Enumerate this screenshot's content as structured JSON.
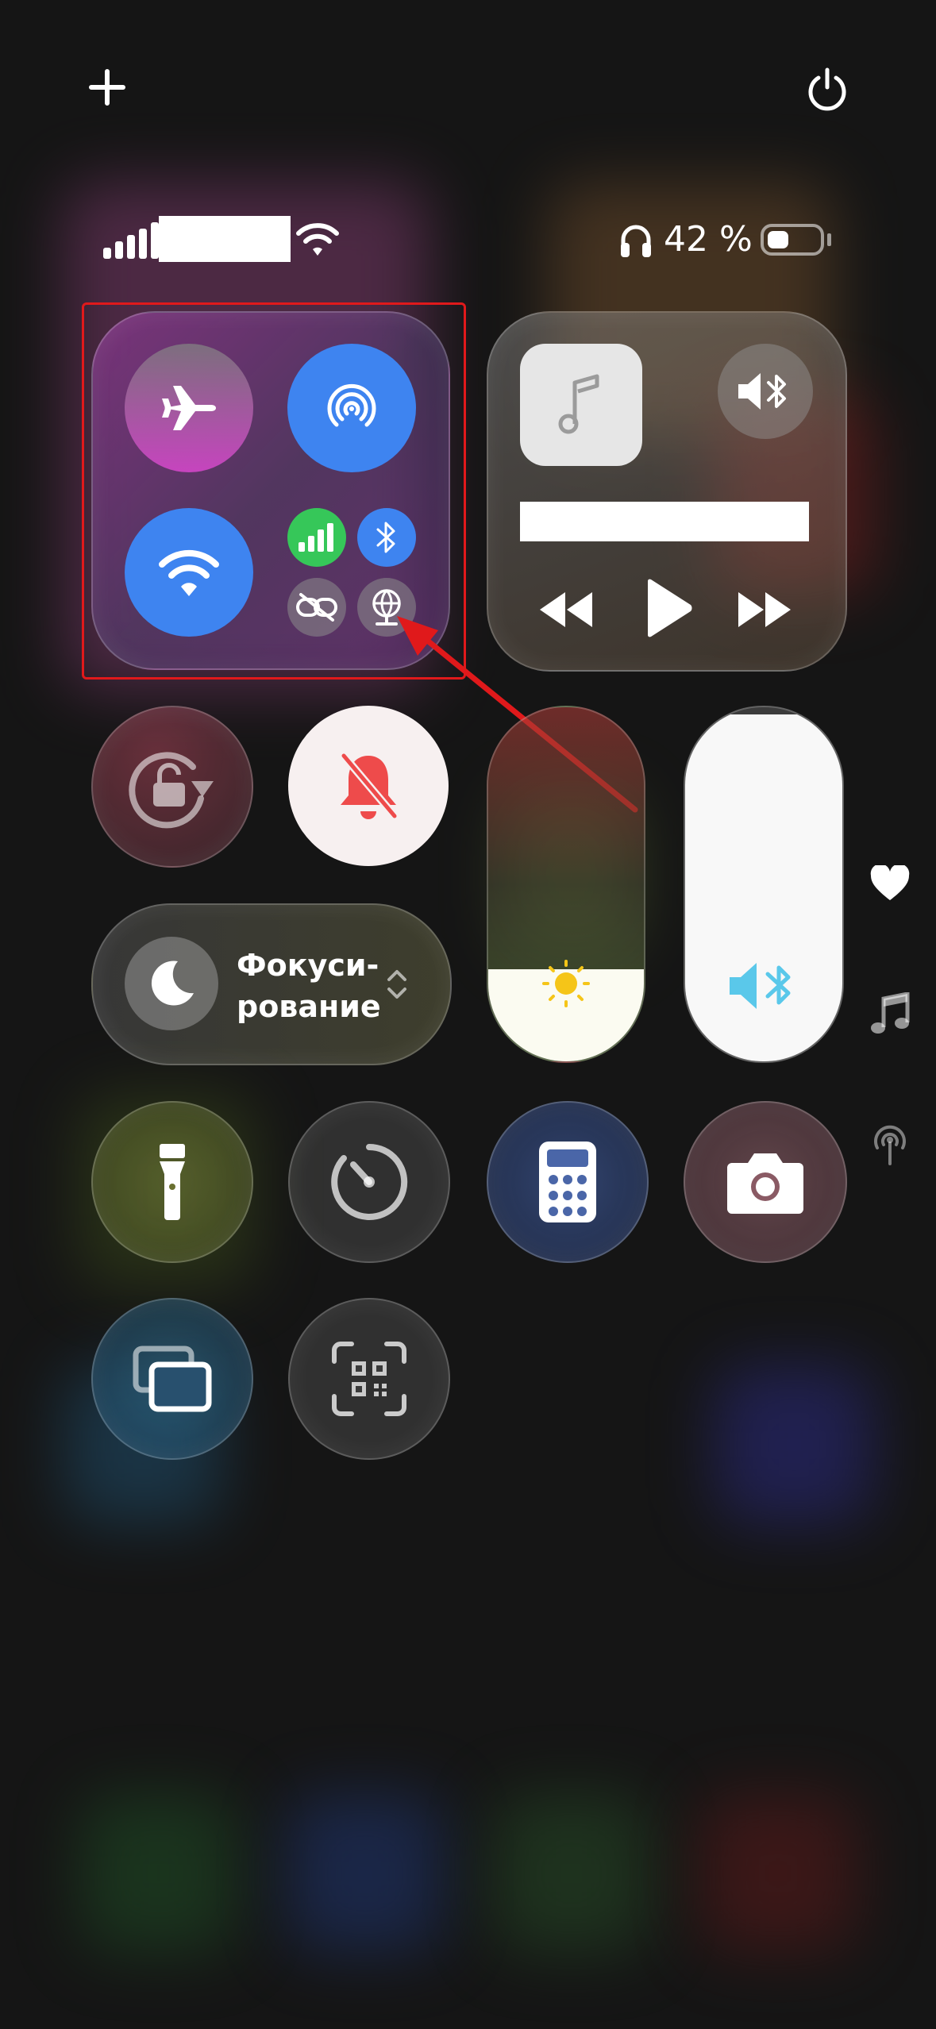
{
  "colors": {
    "accent_blue": "#3e84f0",
    "cellular_green": "#36c759",
    "highlight_red": "#e0191b",
    "mute_red": "#ee4b4b",
    "slider_fill": "#fbfbf1",
    "volume_icon": "#5ac8ea"
  },
  "top_bar": {
    "add_icon": "plus-icon",
    "power_icon": "power-icon"
  },
  "status_bar": {
    "signal_icon": "cellular-signal-icon",
    "carrier_redacted": "",
    "wifi_icon": "wifi-icon",
    "headphones_icon": "headphones-icon",
    "battery_percent": "42 %",
    "battery_level": 0.42
  },
  "connectivity": {
    "airplane": {
      "icon": "airplane-icon",
      "active": false
    },
    "airdrop": {
      "icon": "airdrop-icon",
      "active": true
    },
    "wifi": {
      "icon": "wifi-icon",
      "active": true
    },
    "cellular": {
      "icon": "cellular-data-icon",
      "active": true
    },
    "bluetooth": {
      "icon": "bluetooth-icon",
      "active": true
    },
    "hotspot": {
      "icon": "hotspot-link-icon",
      "active": false
    },
    "vpn": {
      "icon": "network-globe-icon",
      "active": false
    }
  },
  "media": {
    "artwork_icon": "music-note-icon",
    "output_icon": "speaker-bluetooth-icon",
    "title_redacted": "",
    "controls": [
      "rewind-icon",
      "play-icon",
      "fast-forward-icon"
    ]
  },
  "toggles": {
    "orientation_lock": "rotation-lock-icon",
    "silent_mode": "bell-slash-icon"
  },
  "focus": {
    "label": "Фокуси-\nрование",
    "icon": "moon-icon"
  },
  "sliders": {
    "brightness": {
      "icon": "sun-icon",
      "level": 0.26
    },
    "volume": {
      "icon": "speaker-bluetooth-icon",
      "level": 0.98
    }
  },
  "side_rail": [
    "heart-icon",
    "music-note-icon",
    "broadcast-icon"
  ],
  "shortcuts": [
    "flashlight-icon",
    "timer-icon",
    "calculator-icon",
    "camera-icon",
    "screen-mirroring-icon",
    "qr-code-scanner-icon"
  ]
}
